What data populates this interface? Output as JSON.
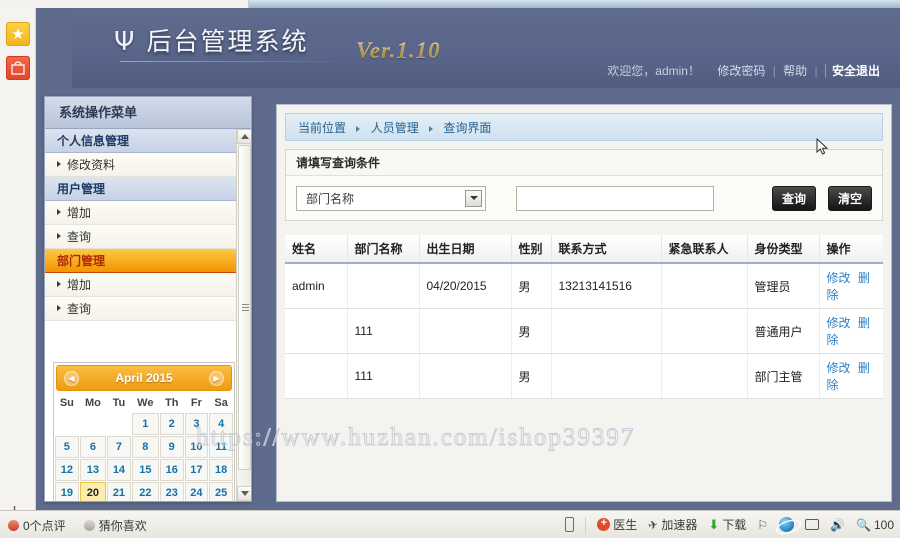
{
  "browser_rail": {
    "star_icon": "star-icon",
    "bag_icon": "shopping-bag-icon",
    "plus_label": "+"
  },
  "header": {
    "logo_glyph": "Ψ",
    "title": "后台管理系统",
    "version": "Ver.1.10",
    "welcome": "欢迎您，admin！",
    "change_password": "修改密码",
    "help": "帮助",
    "logout": "安全退出",
    "separator": "|"
  },
  "sidebar": {
    "title": "系统操作菜单",
    "items": [
      {
        "label": "个人信息管理",
        "type": "group",
        "active": false
      },
      {
        "label": "修改资料",
        "type": "leaf"
      },
      {
        "label": "用户管理",
        "type": "group",
        "active": false
      },
      {
        "label": "增加",
        "type": "leaf"
      },
      {
        "label": "查询",
        "type": "leaf"
      },
      {
        "label": "部门管理",
        "type": "group",
        "active": true
      },
      {
        "label": "增加",
        "type": "leaf"
      },
      {
        "label": "查询",
        "type": "leaf"
      }
    ]
  },
  "calendar": {
    "month_label": "April 2015",
    "prev_icon": "chevron-left-icon",
    "next_icon": "chevron-right-icon",
    "weekdays": [
      "Su",
      "Mo",
      "Tu",
      "We",
      "Th",
      "Fr",
      "Sa"
    ],
    "lead_blanks": 3,
    "days": [
      1,
      2,
      3,
      4,
      5,
      6,
      7,
      8,
      9,
      10,
      11,
      12,
      13,
      14,
      15,
      16,
      17,
      18,
      19,
      20,
      21,
      22,
      23,
      24,
      25
    ],
    "today": 20
  },
  "breadcrumb": {
    "items": [
      "当前位置",
      "人员管理",
      "查询界面"
    ]
  },
  "query_panel": {
    "title": "请填写查询条件",
    "select_value": "部门名称",
    "select_options": [
      "部门名称"
    ],
    "input_value": "",
    "input_placeholder": "",
    "search_button": "查询",
    "clear_button": "清空"
  },
  "table": {
    "columns": [
      "姓名",
      "部门名称",
      "出生日期",
      "性别",
      "联系方式",
      "紧急联系人",
      "身份类型",
      "操作"
    ],
    "rows": [
      {
        "姓名": "admin",
        "部门名称": "",
        "出生日期": "04/20/2015",
        "性别": "男",
        "联系方式": "13213141516",
        "紧急联系人": "",
        "身份类型": "管理员",
        "edit": "修改",
        "delete": "删除"
      },
      {
        "姓名": "",
        "部门名称": "111",
        "出生日期": "",
        "性别": "男",
        "联系方式": "",
        "紧急联系人": "",
        "身份类型": "普通用户",
        "edit": "修改",
        "delete": "删除"
      },
      {
        "姓名": "",
        "部门名称": "111",
        "出生日期": "",
        "性别": "男",
        "联系方式": "",
        "紧急联系人": "",
        "身份类型": "部门主管",
        "edit": "修改",
        "delete": "删除"
      }
    ]
  },
  "watermark": "https://www.huzhan.com/ishop39397",
  "taskbar": {
    "left": [
      {
        "label": "0个点评",
        "icon": "comment-dot-icon"
      },
      {
        "label": "猜你喜欢",
        "icon": "gray-dot-icon"
      }
    ],
    "right": [
      {
        "label": "",
        "icon": "phone-icon"
      },
      {
        "label": "医生",
        "icon": "doctor-plus-icon"
      },
      {
        "label": "加速器",
        "icon": "rocket-icon"
      },
      {
        "label": "下载",
        "icon": "download-arrow-icon"
      },
      {
        "label": "",
        "icon": "flag-icon"
      },
      {
        "label": "",
        "icon": "internet-explorer-icon"
      },
      {
        "label": "",
        "icon": "window-icon"
      },
      {
        "label": "",
        "icon": "speaker-icon"
      },
      {
        "label": "100",
        "icon": "zoom-magnifier-icon"
      }
    ]
  },
  "colors": {
    "header_blue": "#59658a",
    "accent_orange": "#f29400",
    "link_blue": "#2f7fc4",
    "page_bg": "#5e6b8c"
  }
}
